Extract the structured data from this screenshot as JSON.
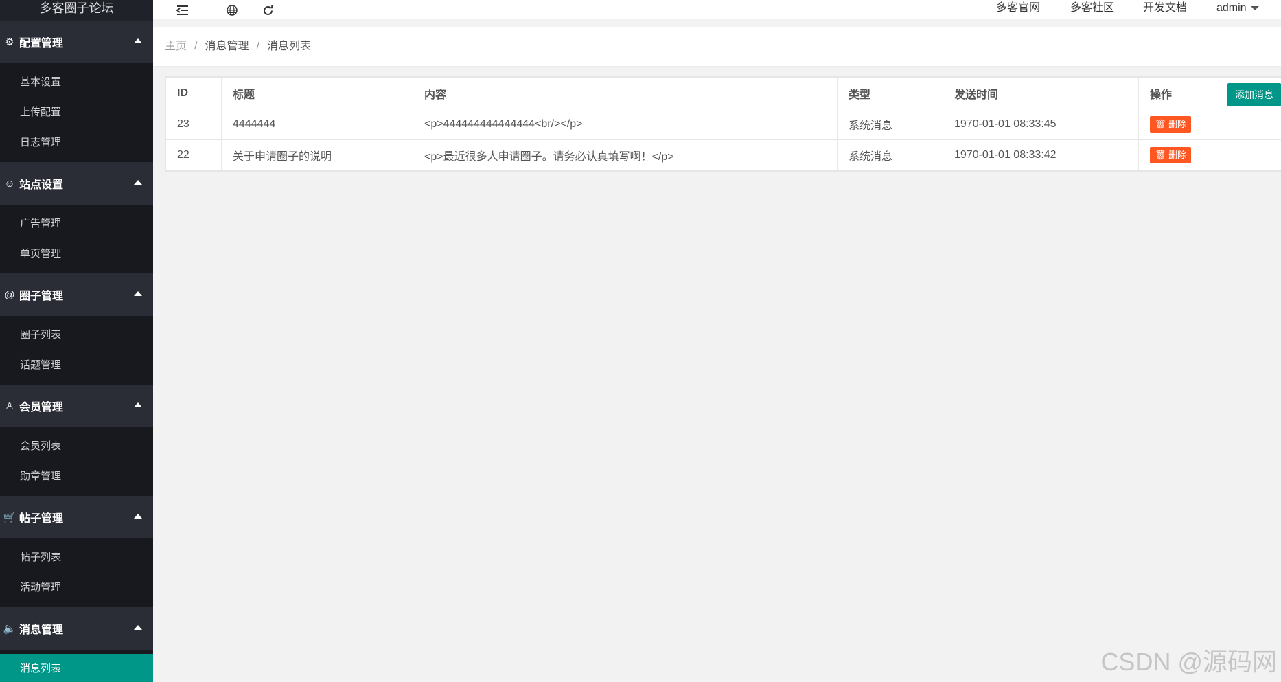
{
  "sidebar": {
    "brand": "多客圈子论坛",
    "groups": [
      {
        "icon": "⚙",
        "title": "配置管理",
        "items": [
          "基本设置",
          "上传配置",
          "日志管理"
        ]
      },
      {
        "icon": "☺",
        "title": "站点设置",
        "items": [
          "广告管理",
          "单页管理"
        ]
      },
      {
        "icon": "@",
        "title": "圈子管理",
        "items": [
          "圈子列表",
          "话题管理"
        ]
      },
      {
        "icon": "♙",
        "title": "会员管理",
        "items": [
          "会员列表",
          "勋章管理"
        ]
      },
      {
        "icon": "🛒",
        "title": "帖子管理",
        "items": [
          "帖子列表",
          "活动管理"
        ]
      },
      {
        "icon": "🔈",
        "title": "消息管理",
        "items": [
          "消息列表"
        ]
      }
    ],
    "active_item": "消息列表"
  },
  "header": {
    "icons": [
      "menu-collapse-icon",
      "globe-icon",
      "refresh-icon"
    ],
    "links": [
      "多客官网",
      "多客社区",
      "开发文档"
    ],
    "user": "admin"
  },
  "breadcrumb": {
    "home": "主页",
    "section": "消息管理",
    "page": "消息列表",
    "separator": "/"
  },
  "table": {
    "columns": [
      "ID",
      "标题",
      "内容",
      "类型",
      "发送时间",
      "操作"
    ],
    "add_button": "添加消息",
    "delete_label": "删除",
    "rows": [
      {
        "id": "23",
        "title": "4444444",
        "content": "<p>444444444444444<br/></p>",
        "type": "系统消息",
        "time": "1970-01-01 08:33:45"
      },
      {
        "id": "22",
        "title": "关于申请圈子的说明",
        "content": "<p>最近很多人申请圈子。请务必认真填写啊！</p>",
        "type": "系统消息",
        "time": "1970-01-01 08:33:42"
      }
    ]
  },
  "watermark": "CSDN @源码网"
}
